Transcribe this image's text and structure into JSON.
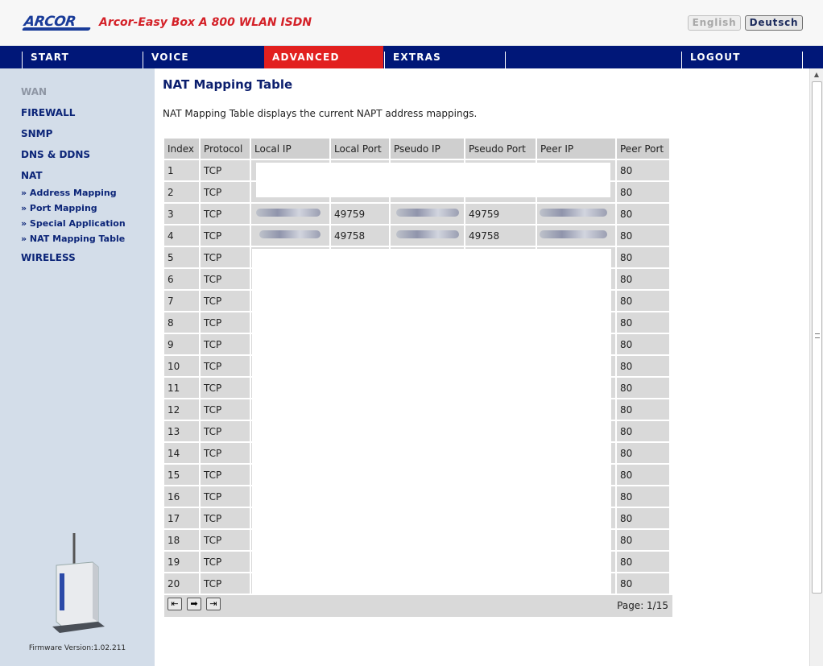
{
  "header": {
    "logo_text": "ARCOR",
    "product_name": "Arcor-Easy Box A 800 WLAN ISDN",
    "lang_english": "English",
    "lang_deutsch": "Deutsch"
  },
  "nav": {
    "items": [
      {
        "label": "START",
        "active": false
      },
      {
        "label": "VOICE",
        "active": false
      },
      {
        "label": "ADVANCED",
        "active": true
      },
      {
        "label": "EXTRAS",
        "active": false
      },
      {
        "label": "LOGOUT",
        "active": false
      }
    ]
  },
  "sidebar": {
    "items": [
      {
        "label": "WAN",
        "state": "dim"
      },
      {
        "label": "FIREWALL"
      },
      {
        "label": "SNMP"
      },
      {
        "label": "DNS & DDNS"
      },
      {
        "label": "NAT"
      }
    ],
    "sub_items": [
      "» Address Mapping",
      "» Port Mapping",
      "» Special Application",
      "» NAT Mapping Table"
    ],
    "after_items": [
      {
        "label": "WIRELESS"
      }
    ],
    "firmware": "Firmware Version:1.02.211"
  },
  "main": {
    "title": "NAT Mapping Table",
    "description": "NAT Mapping Table displays the current NAPT address mappings.",
    "table": {
      "headers": [
        "Index",
        "Protocol",
        "Local IP",
        "Local Port",
        "Pseudo IP",
        "Pseudo Port",
        "Peer IP",
        "Peer Port"
      ],
      "rows": [
        [
          "1",
          "TCP",
          "",
          "",
          "",
          "",
          "",
          "80"
        ],
        [
          "2",
          "TCP",
          "",
          "",
          "",
          "",
          "",
          "80"
        ],
        [
          "3",
          "TCP",
          "",
          "49759",
          "",
          "49759",
          "",
          "80"
        ],
        [
          "4",
          "TCP",
          "",
          "49758",
          "",
          "49758",
          "",
          "80"
        ],
        [
          "5",
          "TCP",
          "",
          "",
          "",
          "",
          "",
          "80"
        ],
        [
          "6",
          "TCP",
          "",
          "",
          "",
          "",
          "",
          "80"
        ],
        [
          "7",
          "TCP",
          "",
          "",
          "",
          "",
          "",
          "80"
        ],
        [
          "8",
          "TCP",
          "",
          "",
          "",
          "",
          "",
          "80"
        ],
        [
          "9",
          "TCP",
          "",
          "",
          "",
          "",
          "",
          "80"
        ],
        [
          "10",
          "TCP",
          "",
          "",
          "",
          "",
          "",
          "80"
        ],
        [
          "11",
          "TCP",
          "",
          "",
          "",
          "",
          "",
          "80"
        ],
        [
          "12",
          "TCP",
          "",
          "",
          "",
          "",
          "",
          "80"
        ],
        [
          "13",
          "TCP",
          "",
          "",
          "",
          "",
          "",
          "80"
        ],
        [
          "14",
          "TCP",
          "",
          "",
          "",
          "",
          "",
          "80"
        ],
        [
          "15",
          "TCP",
          "",
          "",
          "",
          "",
          "",
          "80"
        ],
        [
          "16",
          "TCP",
          "",
          "",
          "",
          "",
          "",
          "80"
        ],
        [
          "17",
          "TCP",
          "",
          "",
          "",
          "",
          "",
          "80"
        ],
        [
          "18",
          "TCP",
          "",
          "",
          "",
          "",
          "",
          "80"
        ],
        [
          "19",
          "TCP",
          "",
          "",
          "",
          "",
          "",
          "80"
        ],
        [
          "20",
          "TCP",
          "",
          "",
          "",
          "",
          "",
          "80"
        ]
      ]
    },
    "pager": {
      "page_label": "Page: 1/15",
      "icons": [
        "first-page-icon",
        "next-page-icon",
        "last-page-icon"
      ]
    }
  },
  "colors": {
    "nav_bg": "#001778",
    "nav_active": "#e2201f",
    "sidebar_bg": "#d3dde9",
    "link": "#0c2578",
    "brand_red": "#d42128"
  }
}
